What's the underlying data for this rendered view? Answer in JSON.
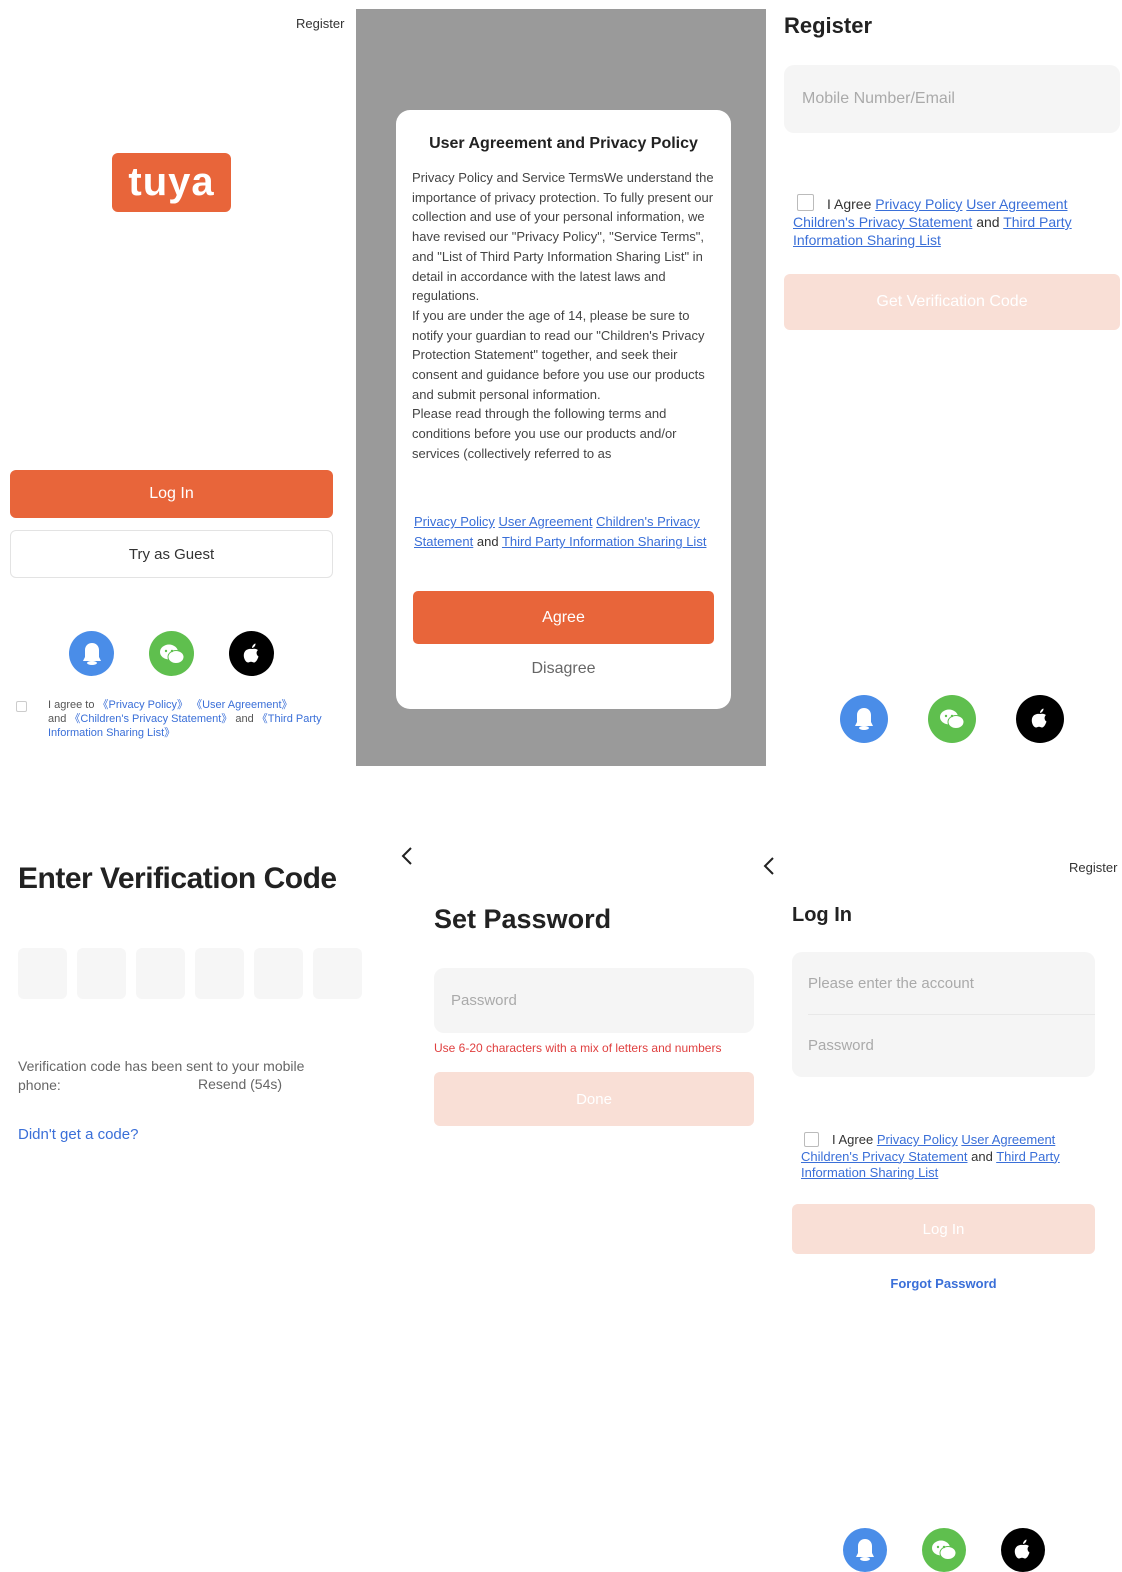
{
  "screen1": {
    "register": "Register",
    "logo_text": "tuya",
    "login_button": "Log In",
    "guest_button": "Try as Guest",
    "agree": {
      "prefix": "I agree to ",
      "privacy": "《Privacy Policy》",
      "user_agreement": "《User Agreement》",
      "and1": "and ",
      "children": "《Children's Privacy Statement》",
      "and2": " and ",
      "third": "《Third Party Information Sharing List》"
    }
  },
  "screen2": {
    "title": "User Agreement and Privacy Policy",
    "body": "Privacy Policy and Service TermsWe understand the importance of privacy protection. To fully present our collection and use of your personal information, we have revised our \"Privacy Policy\", \"Service Terms\", and \"List of Third Party Information Sharing List\" in detail in accordance with the latest laws and regulations.\nIf you are under the age of 14, please be sure to notify your guardian to read our \"Children's Privacy Protection Statement\" together, and seek their consent and guidance before you use our products and submit personal information.\nPlease read through the following terms and conditions before you use our products and/or services (collectively referred to as",
    "links": {
      "privacy": "Privacy Policy",
      "user_agreement": "User Agreement",
      "children": "Children's Privacy Statement",
      "and": " and ",
      "third": "Third Party Information Sharing List"
    },
    "agree_button": "Agree",
    "disagree_button": "Disagree"
  },
  "screen3": {
    "title": "Register",
    "input_placeholder": "Mobile Number/Email",
    "agree": {
      "prefix": "I Agree ",
      "privacy": "Privacy Policy",
      "user_agreement": "User Agreement",
      "children": "Children's Privacy Statement",
      "and": " and ",
      "third": "Third Party Information Sharing List"
    },
    "button": "Get Verification Code"
  },
  "screen4": {
    "title": "Enter Verification Code",
    "code_boxes": [
      "",
      "",
      "",
      "",
      "",
      ""
    ],
    "sent_text": "Verification code has been sent to your mobile phone:",
    "resend": "Resend (54s)",
    "no_code": "Didn't get a code?"
  },
  "screen5": {
    "back": "‹",
    "title": "Set Password",
    "password_placeholder": "Password",
    "hint": "Use 6-20 characters with a mix of letters and numbers",
    "done_button": "Done"
  },
  "screen6": {
    "back": "‹",
    "register": "Register",
    "title": "Log In",
    "account_placeholder": "Please enter the account",
    "password_placeholder": "Password",
    "agree": {
      "prefix": "I Agree ",
      "privacy": "Privacy Policy",
      "user_agreement": "User Agreement",
      "children": "Children's Privacy Statement",
      "and": " and ",
      "third": "Third Party Information Sharing List"
    },
    "login_button": "Log In",
    "forgot": "Forgot Password"
  },
  "colors": {
    "accent": "#e8653a",
    "accent_disabled": "#f9dfd6",
    "link": "#3a6fd8",
    "error": "#e04040",
    "overlay": "#9a9a9a"
  },
  "icons": [
    "bell-icon",
    "wechat-icon",
    "apple-icon",
    "chevron-left-icon"
  ]
}
